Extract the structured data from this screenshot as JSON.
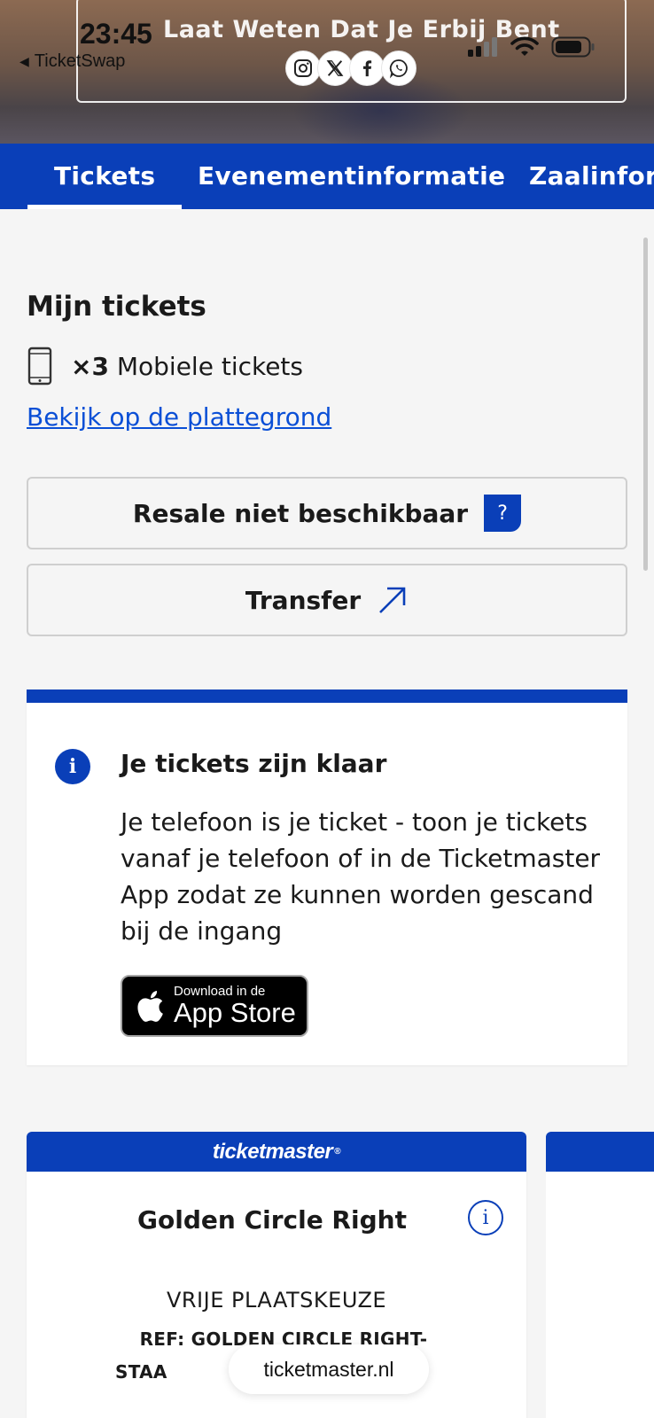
{
  "status_bar": {
    "time": "23:45",
    "back_app": "TicketSwap"
  },
  "hero": {
    "title": "Laat Weten Dat Je Erbij Bent",
    "social": [
      "instagram-icon",
      "x-icon",
      "facebook-icon",
      "whatsapp-icon"
    ]
  },
  "tabs": [
    {
      "label": "Tickets",
      "active": true
    },
    {
      "label": "Evenementinformatie",
      "active": false
    },
    {
      "label": "Zaalinforr",
      "active": false
    }
  ],
  "my_tickets": {
    "title": "Mijn tickets",
    "count": "×3",
    "type": "Mobiele tickets",
    "map_link": "Bekijk op de plattegrond"
  },
  "buttons": {
    "resale": "Resale niet beschikbaar",
    "resale_help": "?",
    "transfer": "Transfer"
  },
  "info_card": {
    "title": "Je tickets zijn klaar",
    "body": "Je telefoon is je ticket - toon je tickets vanaf je telefoon of in de Ticketmaster App zodat ze kunnen worden gescand bij de ingang",
    "appstore_small": "Download in de",
    "appstore_big": "App Store"
  },
  "ticket": {
    "brand": "ticketmaster",
    "section": "Golden Circle Right",
    "seat_type": "VRIJE PLAATSKEUZE",
    "ref_line1": "REF: GOLDEN CIRCLE RIGHT-",
    "ref_line2": "STAA"
  },
  "browser": {
    "url": "ticketmaster.nl"
  },
  "colors": {
    "accent": "#0a3fb8",
    "link": "#0a4fd6",
    "background": "#f5f5f5"
  }
}
